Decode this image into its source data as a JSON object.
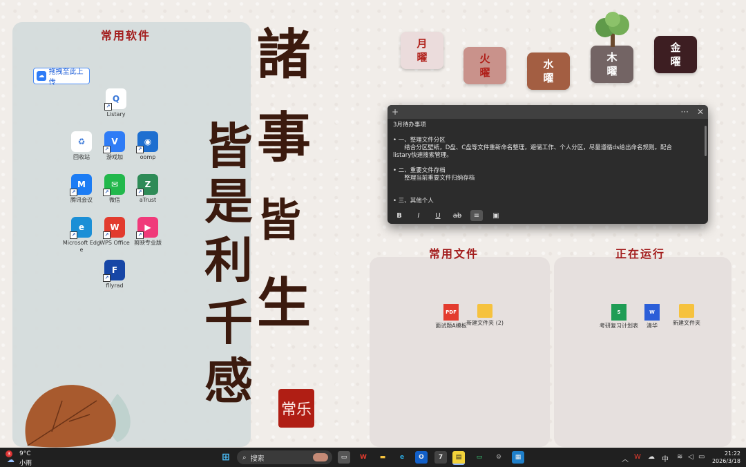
{
  "left_panel": {
    "title": "常用软件",
    "upload_label": "拖拽至此上传",
    "icons": [
      {
        "label": "Listary",
        "color": "#ffffff",
        "fg": "#3a78d8",
        "glyph": "Q"
      },
      {
        "label": "回收站",
        "color": "#ffffff",
        "fg": "#3a78d8",
        "glyph": "♻"
      },
      {
        "label": "游戏加",
        "color": "#2f7cf6",
        "fg": "#fff",
        "glyph": "V"
      },
      {
        "label": "oomp",
        "color": "#1e6fd0",
        "fg": "#fff",
        "glyph": "◉"
      },
      {
        "label": "腾讯会议",
        "color": "#1c7cf4",
        "fg": "#fff",
        "glyph": "M"
      },
      {
        "label": "微信",
        "color": "#22b84c",
        "fg": "#fff",
        "glyph": "✉"
      },
      {
        "label": "aTrust",
        "color": "#2e8b57",
        "fg": "#fff",
        "glyph": "Z"
      },
      {
        "label": "Microsoft Edge",
        "color": "#1b8fd6",
        "fg": "#fff",
        "glyph": "e"
      },
      {
        "label": "WPS Office",
        "color": "#e23b2e",
        "fg": "#fff",
        "glyph": "W"
      },
      {
        "label": "剪映专业版",
        "color": "#f03a7a",
        "fg": "#fff",
        "glyph": "▶"
      },
      {
        "label": "fllyrad",
        "color": "#1746a6",
        "fg": "#fff",
        "glyph": "F"
      }
    ]
  },
  "calligraphy": {
    "col1": [
      "諸",
      "事",
      "皆",
      "生"
    ],
    "col2": [
      "皆",
      "是",
      "利",
      "千",
      "感"
    ],
    "seal": "常乐"
  },
  "days": [
    {
      "top": "月",
      "bottom": "曜",
      "bg": "#ebdcdc",
      "fg": "#b0201a"
    },
    {
      "top": "火",
      "bottom": "曜",
      "bg": "#c9928b",
      "fg": "#b0201a"
    },
    {
      "top": "水",
      "bottom": "曜",
      "bg": "#a35e42",
      "fg": "#fff"
    },
    {
      "top": "木",
      "bottom": "曜",
      "bg": "#736464",
      "fg": "#fff"
    },
    {
      "top": "金",
      "bottom": "曜",
      "bg": "#3d1e22",
      "fg": "#fff"
    }
  ],
  "note": {
    "title": "3月待办事项",
    "lines": [
      "",
      "• 一、整理文件分区",
      "      结合分区壁纸，D盘、C盘等文件重新命名整理，避储工作、个人分区，尽量遵循ds给出命名规则。配合",
      "listary快速搜索管理。",
      "",
      "• 二、重要文件存档",
      "      整理当前重要文件归纳存档",
      "",
      "",
      "• 三、其他个人"
    ],
    "tools": [
      "B",
      "I",
      "U",
      "ab",
      "≡",
      "▣"
    ]
  },
  "files_panel": {
    "title": "常用文件",
    "items": [
      {
        "label": "面试题A模板",
        "type": "PDF",
        "color": "#e33b2e"
      },
      {
        "label": "新建文件夹 (2)",
        "type": "",
        "color": "#f6c23e"
      }
    ]
  },
  "run_panel": {
    "title": "正在运行",
    "items": [
      {
        "label": "考研复习计划表",
        "type": "S",
        "color": "#1f9d55"
      },
      {
        "label": "清华",
        "type": "W",
        "color": "#2b5ed8"
      },
      {
        "label": "新建文件夹",
        "type": "",
        "color": "#f6c23e"
      }
    ]
  },
  "taskbar": {
    "weather_temp": "9°C",
    "weather_desc": "小雨",
    "weather_badge": "3",
    "search_placeholder": "搜索",
    "time": "21:22",
    "date": "2026/3/18",
    "ime": "中"
  }
}
